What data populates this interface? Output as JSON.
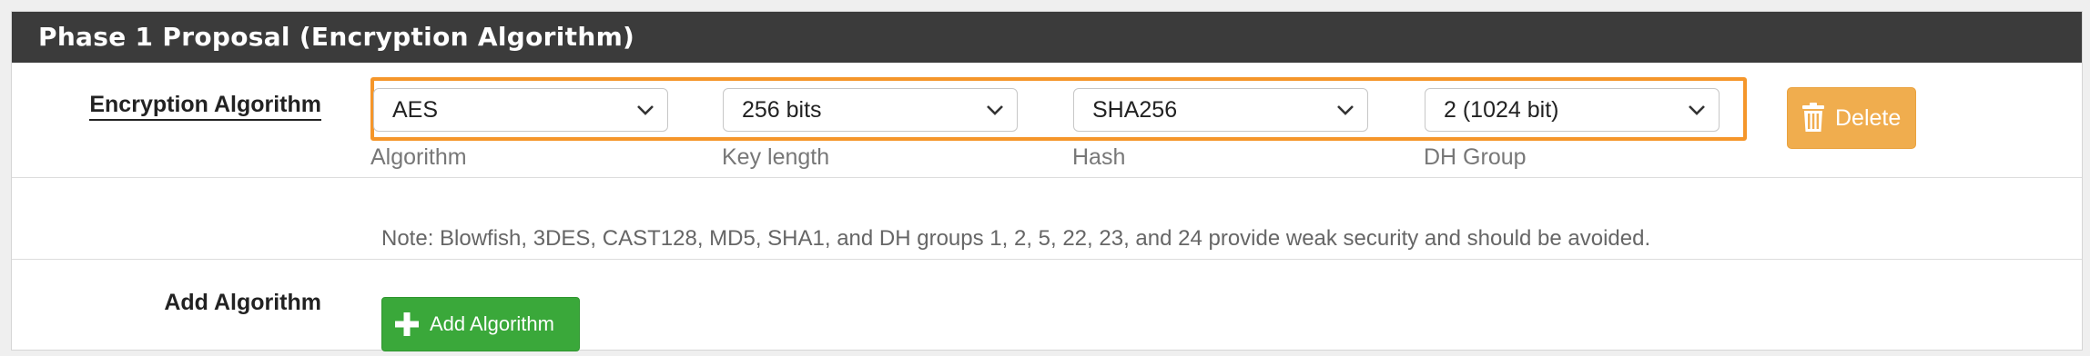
{
  "panel": {
    "title": "Phase 1 Proposal (Encryption Algorithm)"
  },
  "encryption_row": {
    "label": "Encryption Algorithm",
    "algorithm": {
      "value": "AES",
      "help": "Algorithm"
    },
    "key_length": {
      "value": "256 bits",
      "help": "Key length"
    },
    "hash": {
      "value": "SHA256",
      "help": "Hash"
    },
    "dh_group": {
      "value": "2 (1024 bit)",
      "help": "DH Group"
    },
    "delete_label": "Delete"
  },
  "note": "Note: Blowfish, 3DES, CAST128, MD5, SHA1, and DH groups 1, 2, 5, 22, 23, and 24 provide weak security and should be avoided.",
  "add_row": {
    "label": "Add Algorithm",
    "button_label": "Add Algorithm"
  },
  "colors": {
    "heading_bg": "#3b3b3b",
    "highlight": "#f5962a",
    "delete_bg": "#f0ad4e",
    "add_bg": "#3aa83a"
  },
  "icons": {
    "delete": "trash-icon",
    "add": "plus-icon",
    "dropdown": "chevron-down-icon"
  }
}
